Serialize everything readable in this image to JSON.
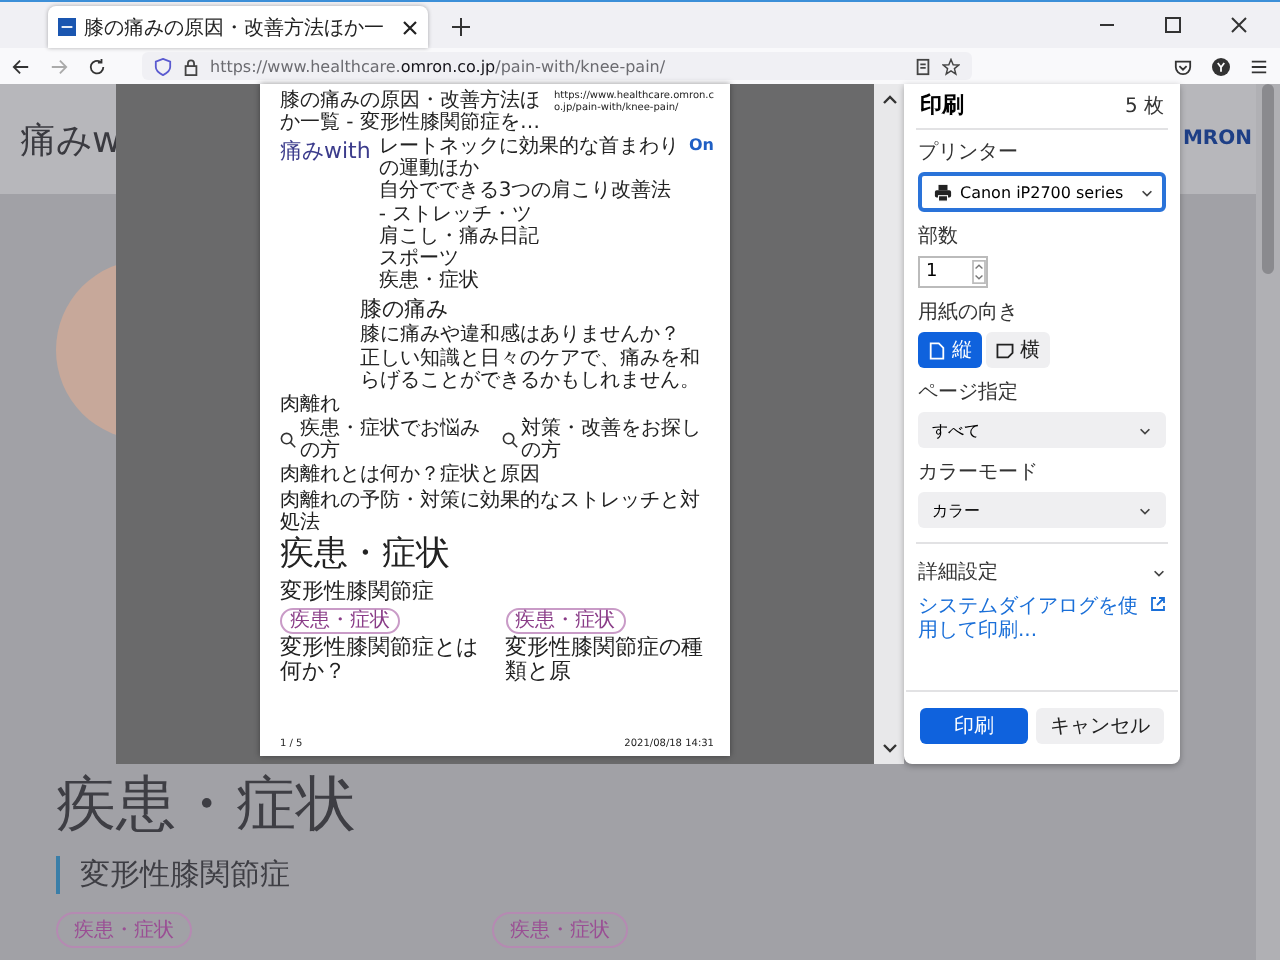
{
  "tab": {
    "title": "膝の痛みの原因・改善方法ほか一"
  },
  "address_bar": {
    "url_prefix": "https://www.healthcare.",
    "url_domain": "omron.co.jp",
    "url_path": "/pain-with/knee-pain/"
  },
  "page": {
    "logo": "痛みw",
    "brand": "MRON",
    "heading": "疾患・症状",
    "subheading": "変形性膝関節症",
    "tags": [
      "疾患・症状",
      "疾患・症状"
    ]
  },
  "print_preview": {
    "header_title": "膝の痛みの原因・改善方法ほか一覧 - 変形性膝関節症を…",
    "header_url": "https://www.healthcare.omron.co.jp/pain-with/knee-pain/",
    "logo": "痛みwith",
    "login": "On",
    "nav_items": [
      "レートネックに効果的な首まわりの運動ほか",
      "自分でできる3つの肩こり改善法 - ストレッチ・ツ",
      "肩こし・痛み日記",
      "スポーツ",
      "疾患・症状"
    ],
    "section_title": "膝の痛み",
    "intro": [
      "膝に痛みや違和感はありませんか？",
      "正しい知識と日々のケアで、痛みを和らげることができるかもしれません。"
    ],
    "label": "肉離れ",
    "search_links": [
      "疾患・症状でお悩みの方",
      "対策・改善をお探しの方"
    ],
    "links": [
      "肉離れとは何か？症状と原因",
      "肉離れの予防・対策に効果的なストレッチと対処法"
    ],
    "heading": "疾患・症状",
    "subheading": "変形性膝関節症",
    "cards": [
      {
        "tag": "疾患・症状",
        "title": "変形性膝関節症とは何か？"
      },
      {
        "tag": "疾患・症状",
        "title": "変形性膝関節症の種類と原"
      }
    ],
    "page_number": "1 / 5",
    "timestamp": "2021/08/18 14:31"
  },
  "print_panel": {
    "title": "印刷",
    "sheets": "5 枚",
    "fields": [
      {
        "kind": "printer",
        "label": "プリンター",
        "value": "Canon iP2700 series",
        "focused": true
      },
      {
        "kind": "number",
        "label": "部数",
        "value": "1"
      },
      {
        "kind": "orientation",
        "label": "用紙の向き",
        "options": [
          {
            "label": "縦",
            "selected": true
          },
          {
            "label": "横",
            "selected": false
          }
        ]
      },
      {
        "kind": "select",
        "label": "ページ指定",
        "value": "すべて"
      },
      {
        "kind": "select",
        "label": "カラーモード",
        "value": "カラー"
      }
    ],
    "more_settings": {
      "label": "詳細設定",
      "expanded": false
    },
    "system_dialog_link": "システムダイアログを使用して印刷...",
    "buttons": [
      {
        "label": "印刷",
        "kind": "primary"
      },
      {
        "label": "キャンセル",
        "kind": "secondary"
      }
    ]
  }
}
